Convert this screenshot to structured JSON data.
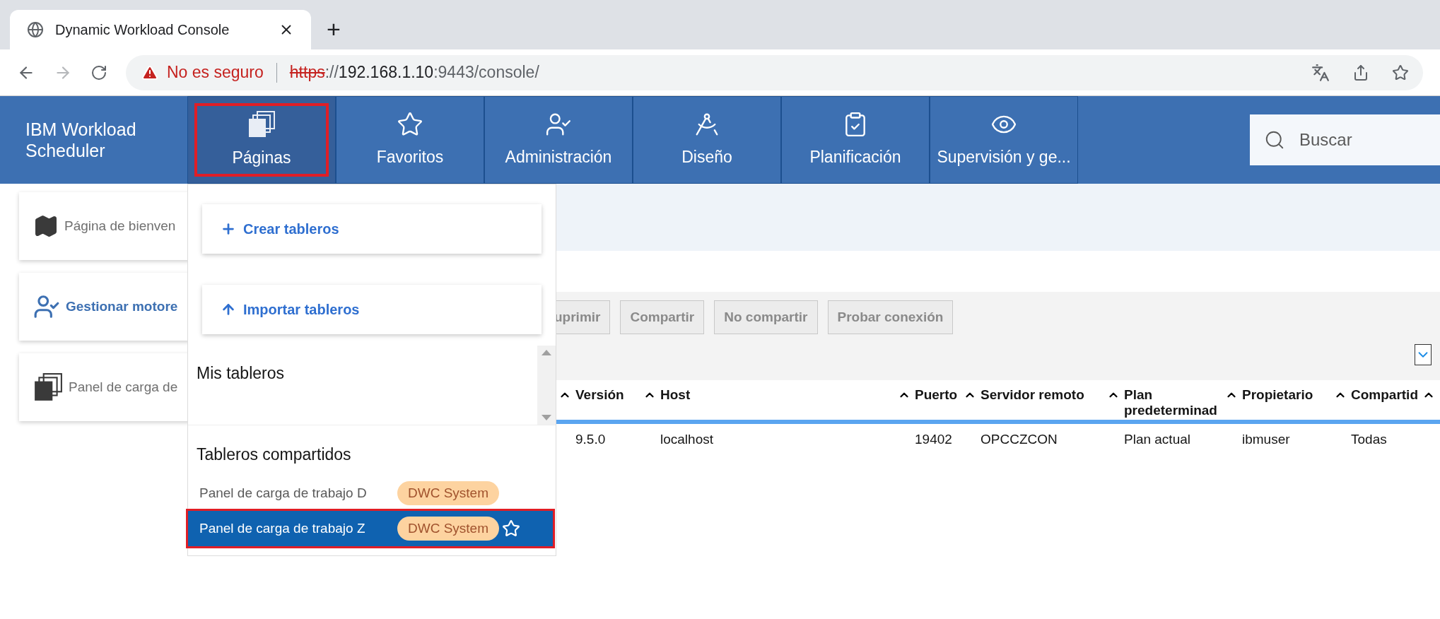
{
  "browser": {
    "tab_title": "Dynamic Workload Console",
    "new_tab": "+",
    "security_label": "No es seguro",
    "url_parts": [
      {
        "kind": "scheme",
        "text": "https"
      },
      {
        "kind": "rest",
        "text": "://"
      },
      {
        "kind": "host",
        "text": "192.168.1.10"
      },
      {
        "kind": "rest",
        "text": ":9443/console/"
      }
    ]
  },
  "header": {
    "brand": "IBM Workload Scheduler",
    "nav": [
      {
        "label": "Páginas",
        "selected": true
      },
      {
        "label": "Favoritos",
        "selected": false
      },
      {
        "label": "Administración",
        "selected": false
      },
      {
        "label": "Diseño",
        "selected": false
      },
      {
        "label": "Planificación",
        "selected": false
      },
      {
        "label": "Supervisión y ge...",
        "selected": false
      }
    ],
    "search": {
      "placeholder": "Buscar"
    }
  },
  "left_cards": [
    {
      "label": "Página de bienven",
      "selected": false
    },
    {
      "label": "Gestionar motore",
      "selected": true
    },
    {
      "label": "Panel de carga de",
      "selected": false
    }
  ],
  "toolbar": [
    {
      "label": "uprimir",
      "disabled": true
    },
    {
      "label": "Compartir",
      "disabled": true
    },
    {
      "label": "No compartir",
      "disabled": true
    },
    {
      "label": "Probar conexión",
      "disabled": true
    }
  ],
  "table": {
    "columns": [
      "Versión",
      "Host",
      "Puerto",
      "Servidor remoto",
      "Plan predeterminad",
      "Propietario",
      "Compartid"
    ],
    "rows": [
      [
        "9.5.0",
        "localhost",
        "19402",
        "OPCCZCON",
        "Plan actual",
        "ibmuser",
        "Todas"
      ]
    ]
  },
  "dropdown": {
    "actions": [
      "Crear tableros",
      "Importar tableros"
    ],
    "my_title": "Mis tableros",
    "shared_title": "Tableros compartidos",
    "shared": [
      {
        "name": "Panel de carga de trabajo D",
        "tag": "DWC System",
        "selected": false
      },
      {
        "name": "Panel de carga de trabajo Z",
        "tag": "DWC System",
        "selected": true
      }
    ]
  }
}
